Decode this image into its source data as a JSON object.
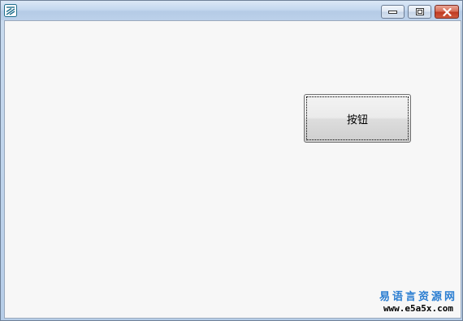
{
  "window": {
    "title": "",
    "icon": "app-logo-icon",
    "caption_buttons": {
      "minimize": "minimize-icon",
      "maximize": "maximize-icon",
      "close": "close-icon"
    }
  },
  "client": {
    "button_label": "按钮"
  },
  "watermark": {
    "site_name": "易语言资源网",
    "url": "www.e5a5x.com"
  },
  "colors": {
    "client_background": "#f7f7f7",
    "close_button": "#c8432b",
    "watermark_text": "#2a7dd1"
  }
}
